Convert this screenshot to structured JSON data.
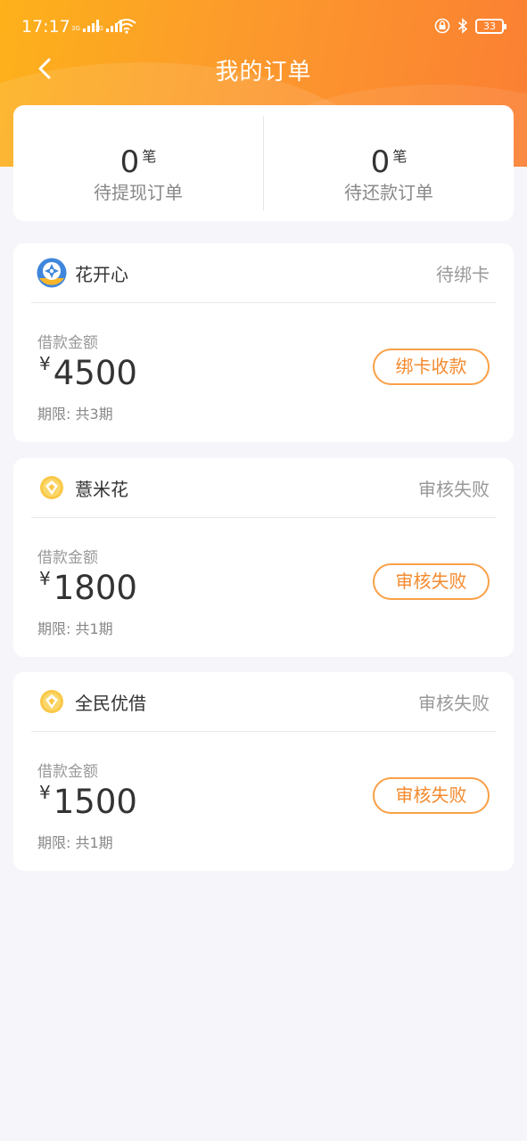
{
  "status_bar": {
    "time": "17:17",
    "signal1_label": "3G",
    "signal2_label": "3G",
    "battery": "33"
  },
  "nav": {
    "title": "我的订单",
    "back_icon": "chevron-left-icon"
  },
  "summary": {
    "pending_withdraw": {
      "count": "0",
      "unit": "笔",
      "label": "待提现订单"
    },
    "pending_repay": {
      "count": "0",
      "unit": "笔",
      "label": "待还款订单"
    }
  },
  "orders": [
    {
      "name": "花开心",
      "status": "待绑卡",
      "amount_label": "借款金额",
      "currency": "¥",
      "amount": "4500",
      "term": "期限: 共3期",
      "action": "绑卡收款",
      "logo": "blue-badge-logo"
    },
    {
      "name": "薏米花",
      "status": "审核失败",
      "amount_label": "借款金额",
      "currency": "¥",
      "amount": "1800",
      "term": "期限: 共1期",
      "action": "审核失败",
      "logo": "yellow-coin-logo"
    },
    {
      "name": "全民优借",
      "status": "审核失败",
      "amount_label": "借款金额",
      "currency": "¥",
      "amount": "1500",
      "term": "期限: 共1期",
      "action": "审核失败",
      "logo": "yellow-coin-logo"
    }
  ],
  "colors": {
    "header_gradient_start": "#fdb11a",
    "header_gradient_end": "#fb7f33",
    "accent_orange": "#f48a2e",
    "background": "#f6f6fa"
  }
}
